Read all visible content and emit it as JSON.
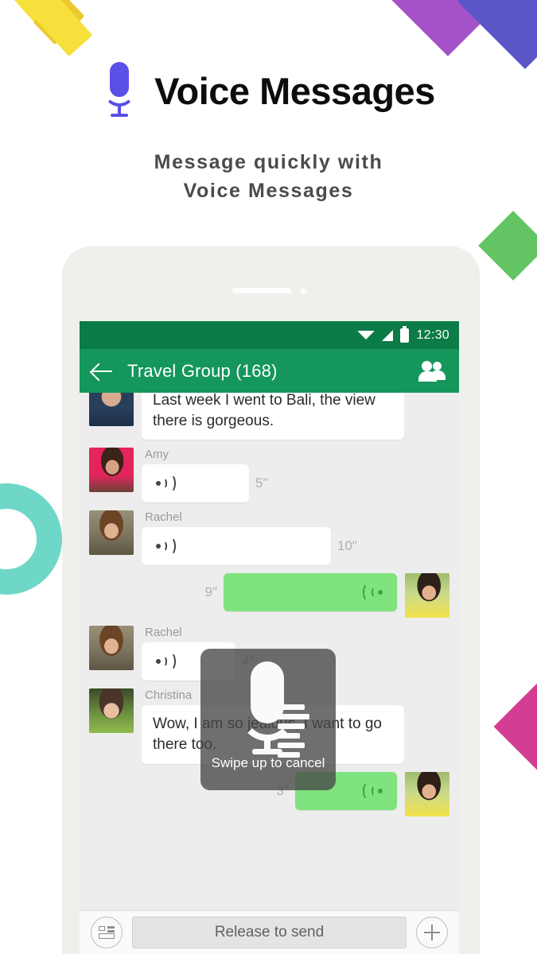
{
  "hero": {
    "title": "Voice Messages",
    "mic_icon": "microphone-icon",
    "subtitle_line1": "Message quickly with",
    "subtitle_line2": "Voice Messages",
    "accent_color": "#5B4FE8"
  },
  "decorations": [
    {
      "name": "yellow-chevron",
      "color": "#F7E03C"
    },
    {
      "name": "yellow-chevron-shadow",
      "color": "#EBC92E"
    },
    {
      "name": "purple-diamond",
      "color": "#A552C8"
    },
    {
      "name": "violet-diamond",
      "color": "#5A56C8"
    },
    {
      "name": "green-diamond",
      "color": "#62C462"
    },
    {
      "name": "magenta-diamond",
      "color": "#D23C92"
    },
    {
      "name": "teal-ring",
      "color": "#6ED7C8"
    }
  ],
  "phone": {
    "statusbar": {
      "time": "12:30",
      "icons": [
        "wifi-icon",
        "signal-icon",
        "battery-icon"
      ],
      "bg_color": "#0B7B47"
    },
    "appbar": {
      "back_icon": "back-arrow-icon",
      "title": "Travel Group (168)",
      "group_icon": "group-members-icon",
      "bg_color": "#14965C"
    },
    "messages": [
      {
        "type": "text",
        "direction": "in",
        "sender": "",
        "avatar": "av-blue",
        "text": "Last week I went to Bali, the view there is gorgeous."
      },
      {
        "type": "voice",
        "direction": "in",
        "sender": "Amy",
        "avatar": "av-amy",
        "duration": "5\"",
        "bubble_width": 135
      },
      {
        "type": "voice",
        "direction": "in",
        "sender": "Rachel",
        "avatar": "av-rachel",
        "duration": "10\"",
        "bubble_width": 238
      },
      {
        "type": "voice",
        "direction": "out",
        "sender": "",
        "avatar": "av-me",
        "duration": "9\"",
        "bubble_width": 218
      },
      {
        "type": "voice",
        "direction": "in",
        "sender": "Rachel",
        "avatar": "av-rachel",
        "duration": "4\"",
        "bubble_width": 118
      },
      {
        "type": "text",
        "direction": "in",
        "sender": "Christina",
        "avatar": "av-christina",
        "text": "Wow, I am so jealous, I want to go there too."
      },
      {
        "type": "voice",
        "direction": "out",
        "sender": "",
        "avatar": "av-me",
        "duration": "3\"",
        "bubble_width": 128
      }
    ],
    "recording_overlay": {
      "mic_icon": "recording-microphone-icon",
      "level_bars": [
        34,
        40,
        34,
        28,
        34,
        28
      ],
      "hint": "Swipe up to cancel"
    },
    "inputbar": {
      "keyboard_icon": "keyboard-toggle-icon",
      "release_label": "Release to send",
      "plus_icon": "plus-icon"
    }
  }
}
